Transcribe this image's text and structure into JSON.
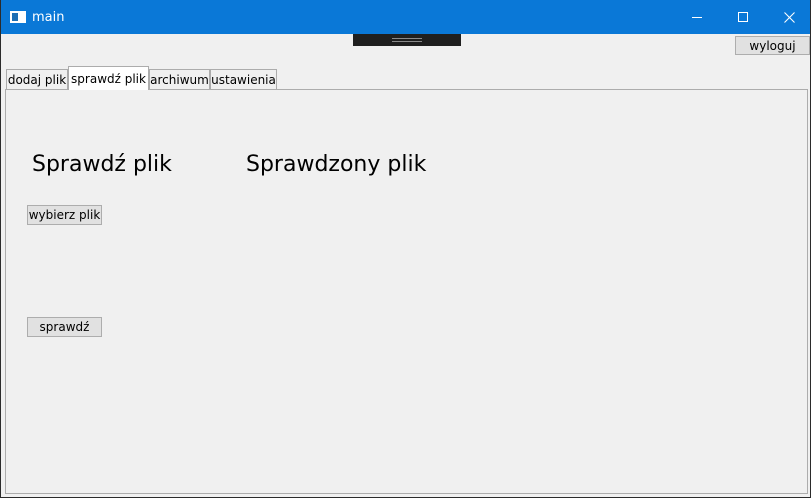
{
  "window": {
    "title": "main",
    "controls": {
      "minimize_icon": "minimize-icon",
      "maximize_icon": "maximize-icon",
      "close_icon": "close-icon"
    },
    "accent_color": "#0a78d7"
  },
  "header": {
    "logout_label": "wyloguj"
  },
  "tabs": [
    {
      "label": "dodaj plik",
      "active": false
    },
    {
      "label": "sprawdź plik",
      "active": true
    },
    {
      "label": "archiwum",
      "active": false
    },
    {
      "label": "ustawienia",
      "active": false
    }
  ],
  "panel": {
    "check_heading": "Sprawdź plik",
    "checked_heading": "Sprawdzony plik",
    "choose_file_label": "wybierz plik",
    "verify_label": "sprawdź"
  }
}
